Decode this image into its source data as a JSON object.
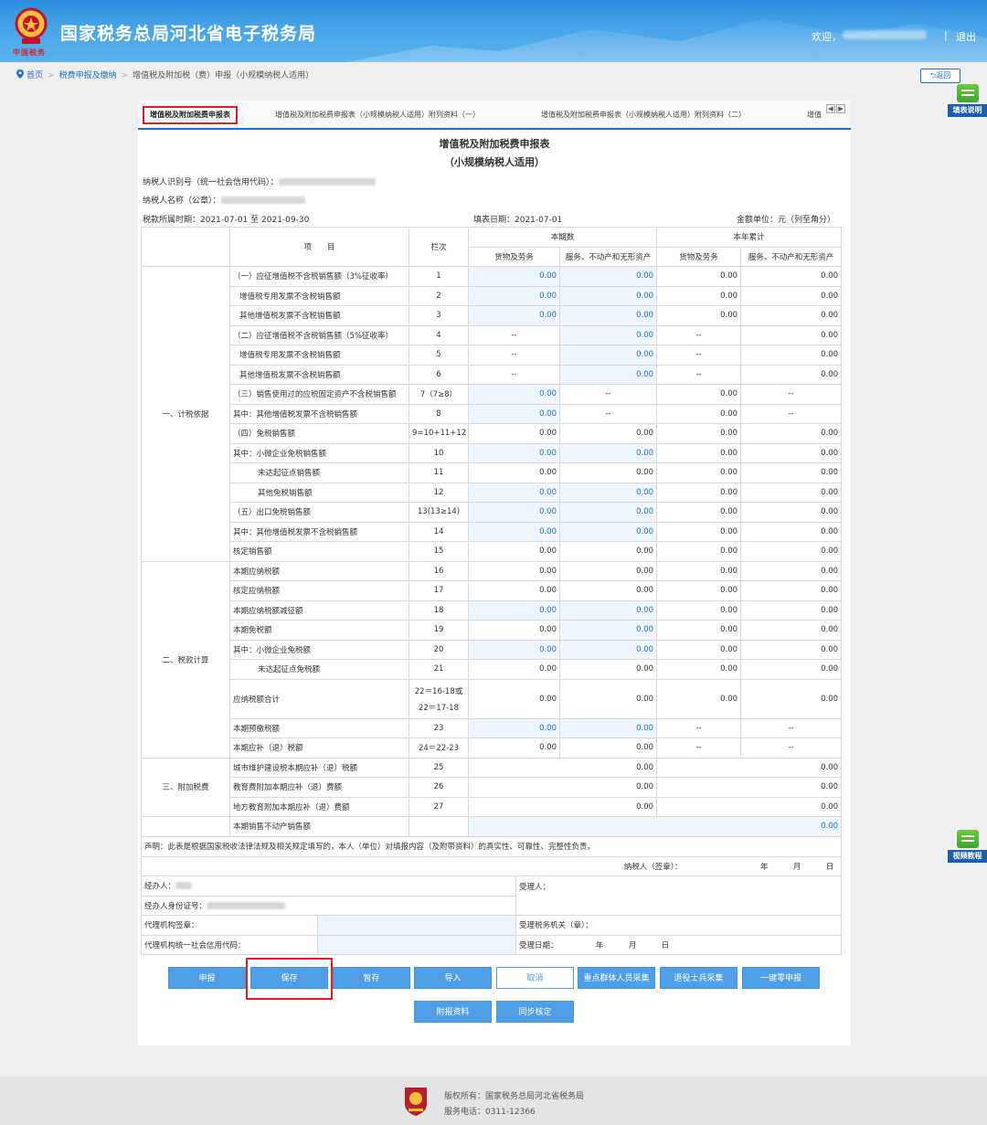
{
  "header": {
    "title": "国家税务总局河北省电子税务局",
    "brand": "中国税务",
    "welcome": "欢迎，",
    "separator": "|",
    "logout": "退出"
  },
  "breadcrumb": {
    "home": "首页",
    "separator": ">",
    "level2": "税费申报及缴纳",
    "current": "增值税及附加税（费）申报（小规模纳税人适用）"
  },
  "back_label": "返回",
  "floaters": {
    "fill_help": "填表说明",
    "video": "视频教程"
  },
  "tabs": [
    "增值税及附加税费申报表",
    "增值税及附加税费申报表（小规模纳税人适用）附列资料（一）",
    "增值税及附加税费申报表（小规模纳税人适用）附列资料（二）",
    "增值"
  ],
  "tab_arrows": {
    "prev": "◀",
    "next": "▶"
  },
  "form": {
    "title": "增值税及附加税费申报表",
    "subtitle": "（小规模纳税人适用）",
    "taxpayer_id_label": "纳税人识别号（统一社会信用代码）：",
    "taxpayer_name_label": "纳税人名称（公章）：",
    "period": "税款所属时期：2021-07-01 至 2021-09-30",
    "fill_date": "填表日期：2021-07-01",
    "unit": "金额单位：元（列至角分）"
  },
  "table": {
    "headers": {
      "item": "项　　目",
      "row_no": "栏次",
      "current": "本期数",
      "ytd": "本年累计",
      "goods": "货物及劳务",
      "services": "服务、不动产和无形资产"
    },
    "sections": {
      "s1": "一、计税依据",
      "s2": "二、税款计算",
      "s3": "三、附加税费"
    },
    "rows": [
      {
        "label": "（一）应征增值税不含税销售额（3%征收率）",
        "no": "1",
        "cur_goods": "0.00",
        "cur_services": "0.00",
        "ytd_goods": "0.00",
        "ytd_services": "0.00"
      },
      {
        "label": "增值税专用发票不含税销售额",
        "no": "2",
        "cur_goods": "0.00",
        "cur_services": "0.00",
        "ytd_goods": "0.00",
        "ytd_services": "0.00"
      },
      {
        "label": "其他增值税发票不含税销售额",
        "no": "3",
        "cur_goods": "0.00",
        "cur_services": "0.00",
        "ytd_goods": "0.00",
        "ytd_services": "0.00"
      },
      {
        "label": "（二）应征增值税不含税销售额（5%征收率）",
        "no": "4",
        "cur_goods": "--",
        "cur_services": "0.00",
        "ytd_goods": "--",
        "ytd_services": "0.00"
      },
      {
        "label": "增值税专用发票不含税销售额",
        "no": "5",
        "cur_goods": "--",
        "cur_services": "0.00",
        "ytd_goods": "--",
        "ytd_services": "0.00"
      },
      {
        "label": "其他增值税发票不含税销售额",
        "no": "6",
        "cur_goods": "--",
        "cur_services": "0.00",
        "ytd_goods": "--",
        "ytd_services": "0.00"
      },
      {
        "label": "（三）销售使用过的应税固定资产不含税销售额",
        "no": "7（7≥8）",
        "cur_goods": "0.00",
        "cur_services": "--",
        "ytd_goods": "0.00",
        "ytd_services": "--"
      },
      {
        "label": "其中：其他增值税发票不含税销售额",
        "no": "8",
        "cur_goods": "0.00",
        "cur_services": "--",
        "ytd_goods": "0.00",
        "ytd_services": "--"
      },
      {
        "label": "（四）免税销售额",
        "no": "9=10+11+12",
        "cur_goods": "0.00",
        "cur_services": "0.00",
        "ytd_goods": "0.00",
        "ytd_services": "0.00"
      },
      {
        "label": "其中：小微企业免税销售额",
        "no": "10",
        "cur_goods": "0.00",
        "cur_services": "0.00",
        "ytd_goods": "0.00",
        "ytd_services": "0.00"
      },
      {
        "label": "未达起征点销售额",
        "no": "11",
        "cur_goods": "0.00",
        "cur_services": "0.00",
        "ytd_goods": "0.00",
        "ytd_services": "0.00"
      },
      {
        "label": "其他免税销售额",
        "no": "12",
        "cur_goods": "0.00",
        "cur_services": "0.00",
        "ytd_goods": "0.00",
        "ytd_services": "0.00"
      },
      {
        "label": "（五）出口免税销售额",
        "no": "13(13≥14)",
        "cur_goods": "0.00",
        "cur_services": "0.00",
        "ytd_goods": "0.00",
        "ytd_services": "0.00"
      },
      {
        "label": "其中：其他增值税发票不含税销售额",
        "no": "14",
        "cur_goods": "0.00",
        "cur_services": "0.00",
        "ytd_goods": "0.00",
        "ytd_services": "0.00"
      },
      {
        "label": "核定销售额",
        "no": "15",
        "cur_goods": "0.00",
        "cur_services": "0.00",
        "ytd_goods": "0.00",
        "ytd_services": "0.00"
      },
      {
        "label": "本期应纳税额",
        "no": "16",
        "cur_goods": "0.00",
        "cur_services": "0.00",
        "ytd_goods": "0.00",
        "ytd_services": "0.00"
      },
      {
        "label": "核定应纳税额",
        "no": "17",
        "cur_goods": "0.00",
        "cur_services": "0.00",
        "ytd_goods": "0.00",
        "ytd_services": "0.00"
      },
      {
        "label": "本期应纳税额减征额",
        "no": "18",
        "cur_goods": "0.00",
        "cur_services": "0.00",
        "ytd_goods": "0.00",
        "ytd_services": "0.00"
      },
      {
        "label": "本期免税额",
        "no": "19",
        "cur_goods": "0.00",
        "cur_services": "0.00",
        "ytd_goods": "0.00",
        "ytd_services": "0.00"
      },
      {
        "label": "其中：小微企业免税额",
        "no": "20",
        "cur_goods": "0.00",
        "cur_services": "0.00",
        "ytd_goods": "0.00",
        "ytd_services": "0.00"
      },
      {
        "label": "未达起征点免税额",
        "no": "21",
        "cur_goods": "0.00",
        "cur_services": "0.00",
        "ytd_goods": "0.00",
        "ytd_services": "0.00"
      },
      {
        "label": "应纳税额合计",
        "no": "22＝16-18或",
        "no2": "22＝17-18",
        "cur_goods": "0.00",
        "cur_services": "0.00",
        "ytd_goods": "0.00",
        "ytd_services": "0.00"
      },
      {
        "label": "本期预缴税额",
        "no": "23",
        "cur_goods": "0.00",
        "cur_services": "0.00",
        "ytd_goods": "--",
        "ytd_services": "--"
      },
      {
        "label": "本期应补（退）税额",
        "no": "24＝22-23",
        "cur_goods": "0.00",
        "cur_services": "0.00",
        "ytd_goods": "--",
        "ytd_services": "--"
      },
      {
        "label": "城市维护建设税本期应补（退）税额",
        "no": "25",
        "cur_merged": "0.00",
        "ytd_merged": "0.00"
      },
      {
        "label": "教育费附加本期应补（退）费额",
        "no": "26",
        "cur_merged": "0.00",
        "ytd_merged": "0.00"
      },
      {
        "label": "地方教育附加本期应补（退）费额",
        "no": "27",
        "cur_merged": "0.00",
        "ytd_merged": "0.00"
      },
      {
        "label": "本期销售不动产销售额",
        "no": "",
        "all_merged": "0.00"
      }
    ]
  },
  "declaration": {
    "text": "声明：此表是根据国家税收法律法规及相关规定填写的，本人（单位）对填报内容（及附带资料）的真实性、可靠性、完整性负责。",
    "signer": "纳税人（签章）：",
    "year": "年",
    "month": "月",
    "day": "日",
    "handler": "经办人：",
    "handler_id": "经办人身份证号：",
    "agency_seal": "代理机构签章：",
    "agency_code": "代理机构统一社会信用代码：",
    "receiver": "受理人：",
    "tax_office": "受理税务机关（章）：",
    "accept_date": "受理日期：",
    "accept_year": "年",
    "accept_month": "月",
    "accept_day": "日"
  },
  "buttons": {
    "declare": "申报",
    "save": "保存",
    "temp_save": "暂存",
    "import": "导入",
    "cancel": "取消",
    "key_groups": "重点群体人员采集",
    "veterans": "退役士兵采集",
    "zero_declare": "一键零申报",
    "attachments": "附报资料",
    "sync_check": "同步核定"
  },
  "footer": {
    "copyright": "版权所有：国家税务总局河北省税务局",
    "phone": "服务电话：0311-12366"
  },
  "colors": {
    "header_blue": "#2a8fdf",
    "link_blue": "#1e6fc8",
    "button_blue": "#4f9fe6",
    "highlight_red": "#e02020",
    "editable_fill": "#eef5fd"
  }
}
